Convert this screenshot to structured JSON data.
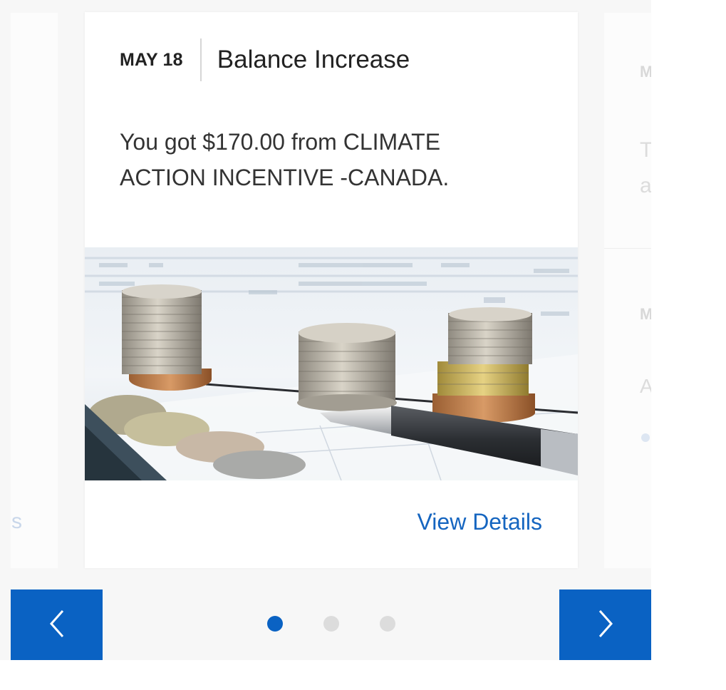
{
  "card": {
    "date": "MAY 18",
    "title": "Balance Increase",
    "message": "You got $170.00 from CLIMATE ACTION INCENTIVE -CANADA.",
    "link_label": "View Details",
    "image_icon": "coins-and-pen-photo"
  },
  "ghost_left": {
    "link_fragment": "s"
  },
  "ghost_right": {
    "date_fragment": "M",
    "text_fragment_1": "T",
    "text_fragment_2": "a",
    "date_fragment_2": "M",
    "title_fragment_2": "A"
  },
  "navigation": {
    "prev_icon": "chevron-left-icon",
    "next_icon": "chevron-right-icon",
    "dots_count": 3,
    "active_index": 0
  },
  "colors": {
    "accent": "#0a62c3",
    "link": "#1565c0",
    "dot_inactive": "#dcdcdc"
  }
}
